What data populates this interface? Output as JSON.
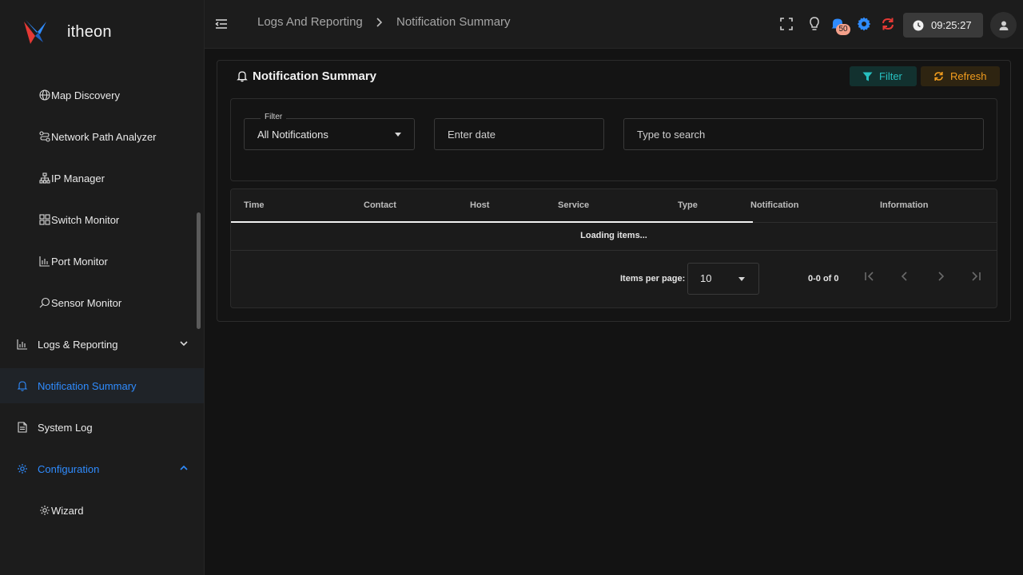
{
  "app": {
    "brand_name": "itheon"
  },
  "sidebar": {
    "items": [
      {
        "label": "Map Discovery",
        "icon": "globe-icon"
      },
      {
        "label": "Network Path Analyzer",
        "icon": "route-icon"
      },
      {
        "label": "IP Manager",
        "icon": "sitemap-icon"
      },
      {
        "label": "Switch Monitor",
        "icon": "grid-icon"
      },
      {
        "label": "Port Monitor",
        "icon": "bar-chart-icon"
      },
      {
        "label": "Sensor Monitor",
        "icon": "sensor-search-icon"
      },
      {
        "label": "Logs & Reporting",
        "icon": "chart-icon"
      },
      {
        "label": "Notification Summary",
        "icon": "bell-icon"
      },
      {
        "label": "System Log",
        "icon": "document-icon"
      },
      {
        "label": "Configuration",
        "icon": "gear-icon"
      },
      {
        "label": "Wizard",
        "icon": "cog-icon"
      }
    ],
    "active_color": "#2f8cff"
  },
  "header": {
    "breadcrumb": [
      "Logs And Reporting",
      "Notification Summary"
    ],
    "notification_count": "50",
    "clock": "09:25:27"
  },
  "main": {
    "title": "Notification Summary",
    "filter_button": "Filter",
    "refresh_button": "Refresh",
    "filters": {
      "type_label": "Filter",
      "type_value": "All Notifications",
      "date_placeholder": "Enter date",
      "search_placeholder": "Type to search"
    },
    "table": {
      "columns": [
        "Time",
        "Contact",
        "Host",
        "Service",
        "Type",
        "Notification",
        "Information"
      ],
      "loading_text": "Loading items..."
    },
    "paginator": {
      "items_per_page_label": "Items per page:",
      "page_size": "10",
      "range": "0-0 of 0"
    }
  },
  "colors": {
    "accent_blue": "#2f8cff",
    "filter_teal": "#27c0c0",
    "refresh_orange": "#f29d1e",
    "sync_red": "#e53935"
  }
}
